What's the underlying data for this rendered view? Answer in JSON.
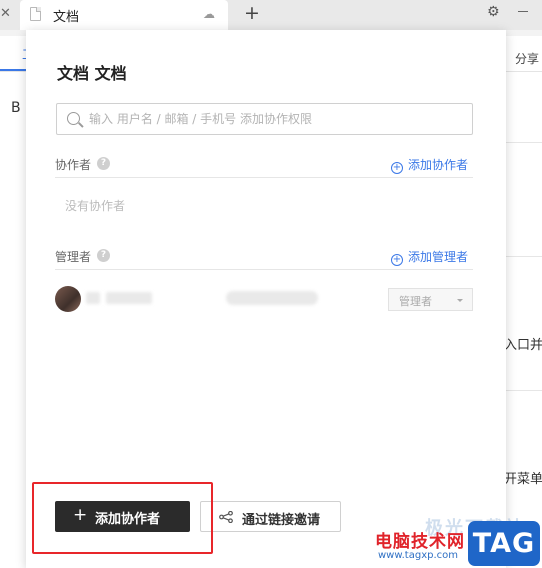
{
  "browser": {
    "tab_title": "文档",
    "new_tab_symbol": "+"
  },
  "background": {
    "toolbar_char": "工",
    "left_char": "B",
    "share_label": "分享",
    "right_text_1": "入口并",
    "right_text_2": "开菜单"
  },
  "panel": {
    "title": "文档 文档",
    "search_placeholder": "输入 用户名 / 邮箱 / 手机号 添加协作权限",
    "collaborators": {
      "label": "协作者",
      "help": "?",
      "add_label": "添加协作者",
      "empty_text": "没有协作者"
    },
    "managers": {
      "label": "管理者",
      "help": "?",
      "add_label": "添加管理者",
      "role_value": "管理者"
    },
    "primary_button": {
      "icon": "+",
      "label": "添加协作者"
    },
    "secondary_button": {
      "label": "通过链接邀请"
    }
  },
  "annotation": {
    "highlight_color": "#e8262a"
  },
  "watermark": {
    "faded_text": "极光下载站",
    "main_text": "电脑技术网",
    "url": "www.tagxp.com",
    "badge": "TAG"
  },
  "colors": {
    "accent": "#3b78e7",
    "primary_button_bg": "#2b2b2b",
    "watermark_red": "#e0232a",
    "watermark_blue": "#1f66c8"
  }
}
